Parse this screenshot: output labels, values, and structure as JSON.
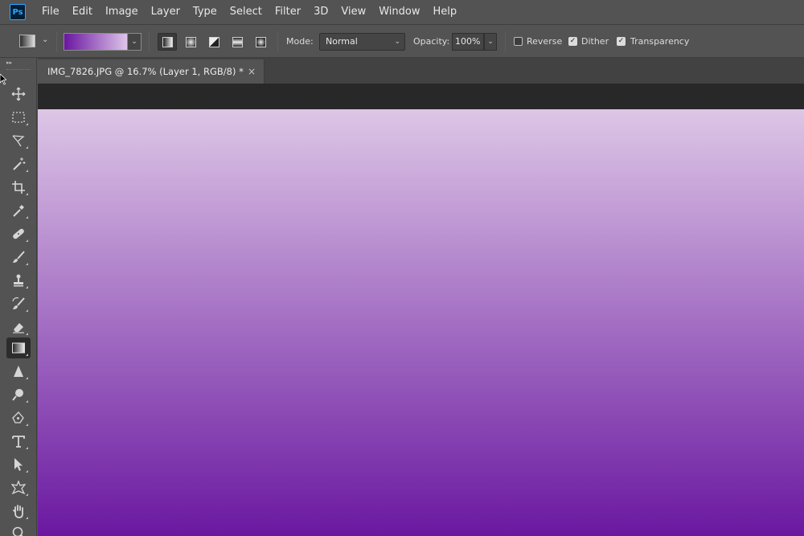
{
  "app": {
    "logo_text": "Ps"
  },
  "menu": [
    "File",
    "Edit",
    "Image",
    "Layer",
    "Type",
    "Select",
    "Filter",
    "3D",
    "View",
    "Window",
    "Help"
  ],
  "options": {
    "gradient": {
      "start_color": "#6a16a0",
      "end_color": "#ddc4e8"
    },
    "gradient_types": [
      "linear",
      "radial",
      "angle",
      "reflected",
      "diamond"
    ],
    "active_gradient_type": "linear",
    "mode_label": "Mode:",
    "mode_value": "Normal",
    "opacity_label": "Opacity:",
    "opacity_value": "100%",
    "reverse_label": "Reverse",
    "reverse_checked": false,
    "dither_label": "Dither",
    "dither_checked": true,
    "transparency_label": "Transparency",
    "transparency_checked": true
  },
  "document": {
    "tab_title": "IMG_7826.JPG @ 16.7% (Layer 1, RGB/8) *",
    "close_glyph": "×",
    "canvas_gradient": {
      "top_color": "#ddc6e6",
      "bottom_color": "#6a18a0"
    }
  },
  "tools": [
    "move",
    "marquee",
    "lasso",
    "quick-select",
    "crop",
    "eyedropper",
    "healing",
    "brush",
    "stamp",
    "history-brush",
    "eraser",
    "gradient",
    "sharpen",
    "dodge",
    "pen",
    "type",
    "path-select",
    "custom-shape",
    "hand",
    "zoom"
  ],
  "active_tool": "gradient",
  "colors": {
    "ui_bg": "#535353",
    "ui_dark": "#282828",
    "accent_ps": "#31a8ff"
  }
}
